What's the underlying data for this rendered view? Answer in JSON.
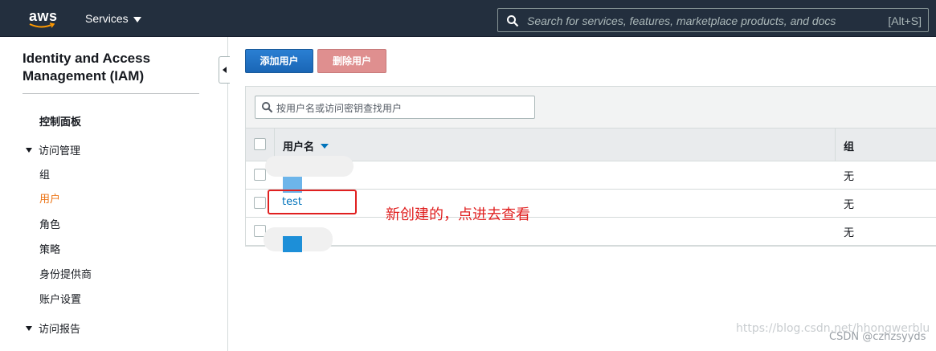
{
  "topbar": {
    "logo_text": "aws",
    "services_label": "Services",
    "search_placeholder": "Search for services, features, marketplace products, and docs",
    "search_shortcut": "[Alt+S]"
  },
  "sidebar": {
    "title": "Identity and Access Management (IAM)",
    "dashboard": "控制面板",
    "group_access_management": "访问管理",
    "items": [
      {
        "label": "组"
      },
      {
        "label": "用户"
      },
      {
        "label": "角色"
      },
      {
        "label": "策略"
      },
      {
        "label": "身份提供商"
      },
      {
        "label": "账户设置"
      }
    ],
    "group_access_reports": "访问报告"
  },
  "actions": {
    "add_user": "添加用户",
    "delete_user": "删除用户"
  },
  "table": {
    "filter_placeholder": "按用户名或访问密钥查找用户",
    "col_username": "用户名",
    "col_group": "组",
    "rows": [
      {
        "name": "",
        "group": "无"
      },
      {
        "name": "test",
        "group": "无"
      },
      {
        "name": "",
        "group": "无"
      }
    ]
  },
  "annotation": {
    "text": "新创建的，点进去查看"
  },
  "footer": {
    "watermark": "https://blog.csdn.net/hhongwerblu",
    "credit": "CSDN @czhzsyyds"
  },
  "colors": {
    "nav_bg": "#232f3e",
    "primary": "#1a66b5",
    "link": "#0073bb",
    "active": "#ec7211",
    "annotation": "#e02020"
  }
}
